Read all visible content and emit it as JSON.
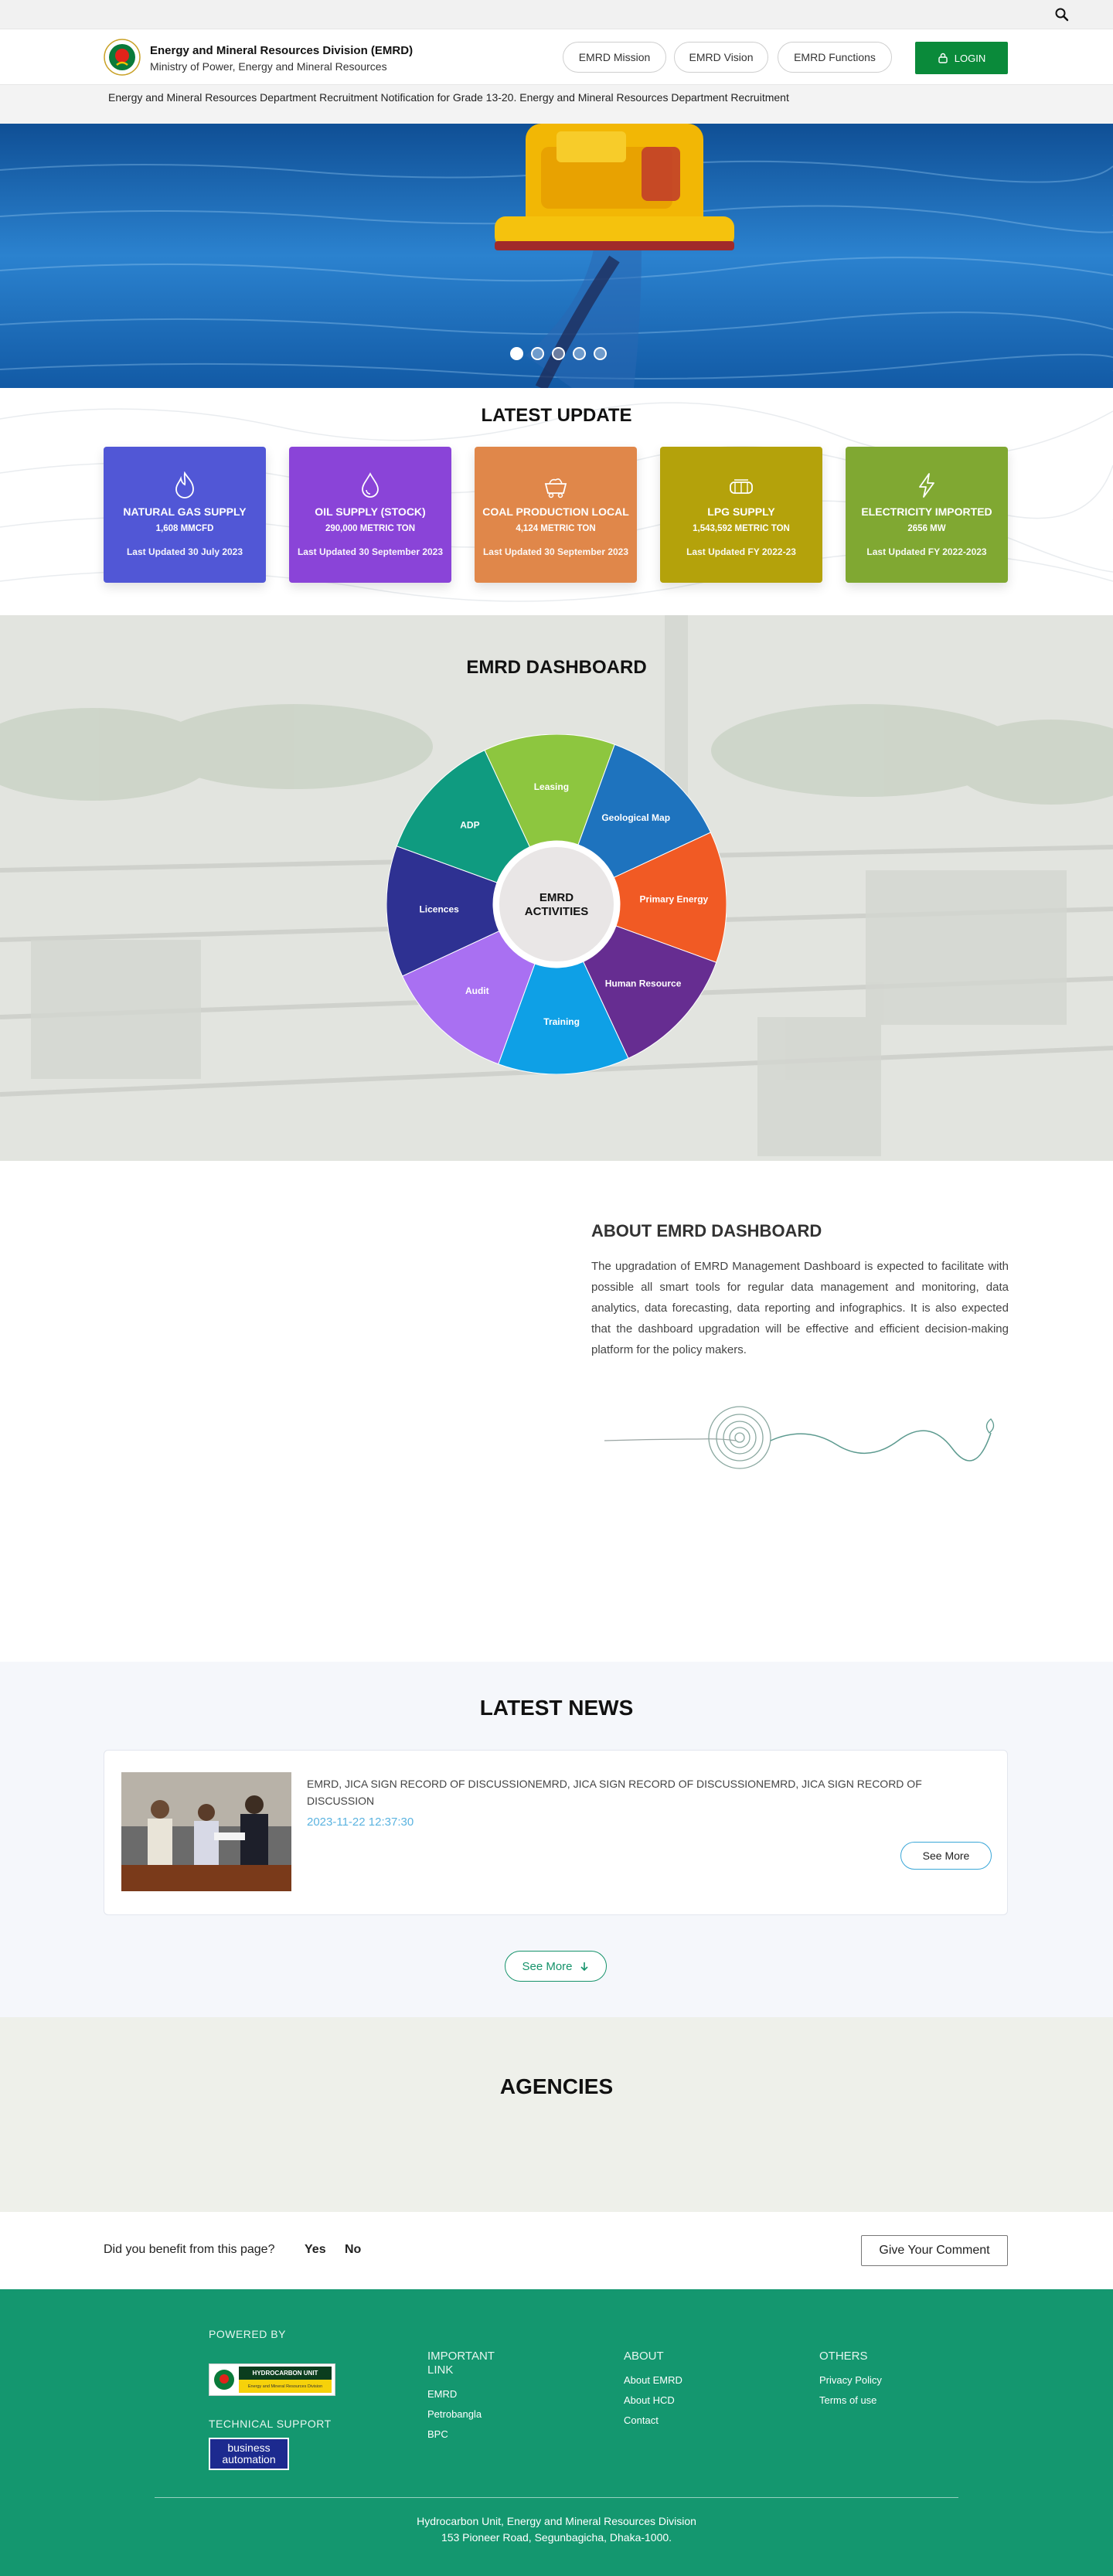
{
  "header": {
    "org_title": "Energy and Mineral Resources Division (EMRD)",
    "org_subtitle": "Ministry of Power, Energy and Mineral Resources",
    "nav": [
      "EMRD Mission",
      "EMRD Vision",
      "EMRD Functions"
    ],
    "login_label": "LOGIN"
  },
  "ticker": "Energy and Mineral Resources Department Recruitment Notification for Grade 13-20. Energy and Mineral Resources Department Recruitment",
  "hero": {
    "slides": 5,
    "active_slide": 1
  },
  "updates": {
    "title": "LATEST UPDATE",
    "cards": [
      {
        "title": "NATURAL GAS SUPPLY",
        "value": "1,608 MMCFD",
        "updated": "Last Updated 30 July 2023",
        "color": "#5157d6",
        "icon": "gas-flame-icon"
      },
      {
        "title": "OIL SUPPLY (STOCK)",
        "value": "290,000 METRIC TON",
        "updated": "Last Updated 30 September 2023",
        "color": "#8a44d8",
        "icon": "oil-drop-icon"
      },
      {
        "title": "COAL PRODUCTION LOCAL",
        "value": "4,124 METRIC TON",
        "updated": "Last Updated 30 September 2023",
        "color": "#e0874a",
        "icon": "coal-cart-icon"
      },
      {
        "title": "LPG SUPPLY",
        "value": "1,543,592 METRIC TON",
        "updated": "Last Updated FY 2022-23",
        "color": "#b4a20b",
        "icon": "lpg-cylinder-icon"
      },
      {
        "title": "ELECTRICITY IMPORTED",
        "value": "2656 MW",
        "updated": "Last Updated FY 2022-2023",
        "color": "#80a832",
        "icon": "lightning-icon"
      }
    ]
  },
  "dashboard": {
    "title": "EMRD DASHBOARD",
    "center_label": "EMRD ACTIVITIES",
    "segments": [
      {
        "label": "Leasing",
        "color": "#8dc63f"
      },
      {
        "label": "Geological Map",
        "color": "#1e73be"
      },
      {
        "label": "Primary Energy",
        "color": "#f15a24"
      },
      {
        "label": "Human Resource",
        "color": "#662d91"
      },
      {
        "label": "Training",
        "color": "#0ea0e6"
      },
      {
        "label": "Audit",
        "color": "#a970f2"
      },
      {
        "label": "Licences",
        "color": "#2e3192"
      },
      {
        "label": "ADP",
        "color": "#0f9b80"
      }
    ]
  },
  "about": {
    "title": "ABOUT EMRD DASHBOARD",
    "text": "The upgradation of EMRD Management Dashboard is expected to facilitate with possible all smart tools for regular data management and monitoring, data analytics, data forecasting, data reporting and infographics. It is also expected that the dashboard upgradation will be effective and efficient decision-making platform for the policy makers."
  },
  "news": {
    "title": "LATEST NEWS",
    "items": [
      {
        "headline": "EMRD, JICA SIGN RECORD OF DISCUSSIONEMRD, JICA SIGN RECORD OF DISCUSSIONEMRD, JICA SIGN RECORD OF DISCUSSION",
        "date": "2023-11-22 12:37:30",
        "button": "See More"
      }
    ],
    "see_more": "See More"
  },
  "agencies": {
    "title": "AGENCIES"
  },
  "feedback": {
    "question": "Did you benefit from this page?",
    "yes": "Yes",
    "no": "No",
    "comment_button": "Give Your Comment"
  },
  "footer": {
    "powered_by": "POWERED BY",
    "powered_logo_text": "HYDROCARBON UNIT",
    "powered_logo_sub": "Energy and Mineral Resources Division",
    "technical_support": "TECHNICAL SUPPORT",
    "tech_logo_line1": "business",
    "tech_logo_line2": "automation",
    "columns": [
      {
        "heading": "IMPORTANT LINK",
        "links": [
          "EMRD",
          "Petrobangla",
          "BPC"
        ]
      },
      {
        "heading": "ABOUT",
        "links": [
          "About EMRD",
          "About HCD",
          "Contact"
        ]
      },
      {
        "heading": "OTHERS",
        "links": [
          "Privacy Policy",
          "Terms of use"
        ]
      }
    ],
    "address_line1": "Hydrocarbon Unit, Energy and Mineral Resources Division",
    "address_line2": "153 Pioneer Road, Segunbagicha, Dhaka-1000."
  }
}
